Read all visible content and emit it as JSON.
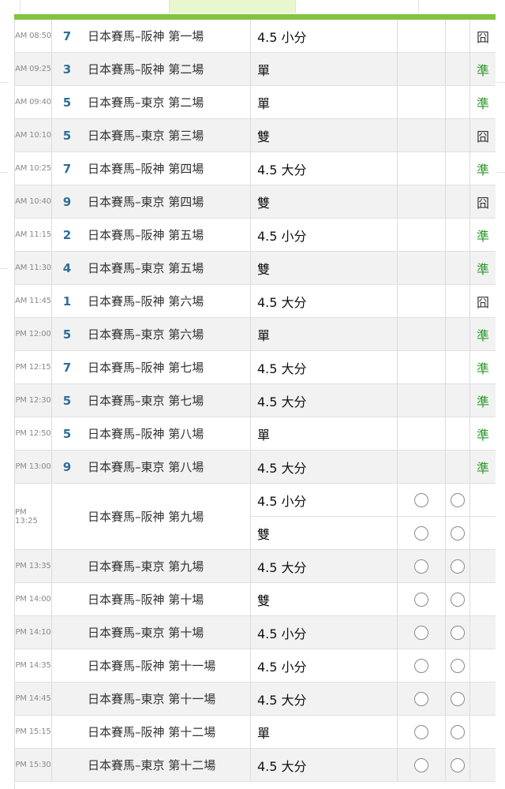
{
  "statuses": {
    "ok": "準",
    "closed": "囧"
  },
  "rows": [
    {
      "time": "AM 08:50",
      "num": "7",
      "race": "日本賽馬–阪神 第一場",
      "bet": "4.5 小分",
      "status": "closed",
      "radios": false
    },
    {
      "time": "AM 09:25",
      "num": "3",
      "race": "日本賽馬–阪神 第二場",
      "bet": "單",
      "status": "ok",
      "radios": false
    },
    {
      "time": "AM 09:40",
      "num": "5",
      "race": "日本賽馬–東京 第二場",
      "bet": "單",
      "status": "ok",
      "radios": false
    },
    {
      "time": "AM 10:10",
      "num": "5",
      "race": "日本賽馬–東京 第三場",
      "bet": "雙",
      "status": "closed",
      "radios": false
    },
    {
      "time": "AM 10:25",
      "num": "7",
      "race": "日本賽馬–阪神 第四場",
      "bet": "4.5 大分",
      "status": "ok",
      "radios": false
    },
    {
      "time": "AM 10:40",
      "num": "9",
      "race": "日本賽馬–東京 第四場",
      "bet": "雙",
      "status": "closed",
      "radios": false
    },
    {
      "time": "AM 11:15",
      "num": "2",
      "race": "日本賽馬–阪神 第五場",
      "bet": "4.5 小分",
      "status": "ok",
      "radios": false
    },
    {
      "time": "AM 11:30",
      "num": "4",
      "race": "日本賽馬–東京 第五場",
      "bet": "雙",
      "status": "ok",
      "radios": false
    },
    {
      "time": "AM 11:45",
      "num": "1",
      "race": "日本賽馬–阪神 第六場",
      "bet": "4.5 大分",
      "status": "closed",
      "radios": false
    },
    {
      "time": "PM 12:00",
      "num": "5",
      "race": "日本賽馬–東京 第六場",
      "bet": "單",
      "status": "ok",
      "radios": false
    },
    {
      "time": "PM 12:15",
      "num": "7",
      "race": "日本賽馬–阪神 第七場",
      "bet": "4.5 大分",
      "status": "ok",
      "radios": false
    },
    {
      "time": "PM 12:30",
      "num": "5",
      "race": "日本賽馬–東京 第七場",
      "bet": "4.5 大分",
      "status": "ok",
      "radios": false
    },
    {
      "time": "PM 12:50",
      "num": "5",
      "race": "日本賽馬–阪神 第八場",
      "bet": "單",
      "status": "ok",
      "radios": false
    },
    {
      "time": "PM 13:00",
      "num": "9",
      "race": "日本賽馬–東京 第八場",
      "bet": "4.5 大分",
      "status": "ok",
      "radios": false
    },
    {
      "time": "PM 13:25",
      "num": "",
      "race": "日本賽馬–阪神 第九場",
      "bets": [
        "4.5 小分",
        "雙"
      ],
      "status": "",
      "radios": true
    },
    {
      "time": "PM 13:35",
      "num": "",
      "race": "日本賽馬–東京 第九場",
      "bet": "4.5 大分",
      "status": "",
      "radios": true
    },
    {
      "time": "PM 14:00",
      "num": "",
      "race": "日本賽馬–阪神 第十場",
      "bet": "雙",
      "status": "",
      "radios": true
    },
    {
      "time": "PM 14:10",
      "num": "",
      "race": "日本賽馬–東京 第十場",
      "bet": "4.5 小分",
      "status": "",
      "radios": true
    },
    {
      "time": "PM 14:35",
      "num": "",
      "race": "日本賽馬–阪神 第十一場",
      "bet": "4.5 小分",
      "status": "",
      "radios": true
    },
    {
      "time": "PM 14:45",
      "num": "",
      "race": "日本賽馬–東京 第十一場",
      "bet": "4.5 大分",
      "status": "",
      "radios": true
    },
    {
      "time": "PM 15:15",
      "num": "",
      "race": "日本賽馬–阪神 第十二場",
      "bet": "單",
      "status": "",
      "radios": true
    },
    {
      "time": "PM 15:30",
      "num": "",
      "race": "日本賽馬–東京 第十二場",
      "bet": "4.5 大分",
      "status": "",
      "radios": true
    }
  ]
}
